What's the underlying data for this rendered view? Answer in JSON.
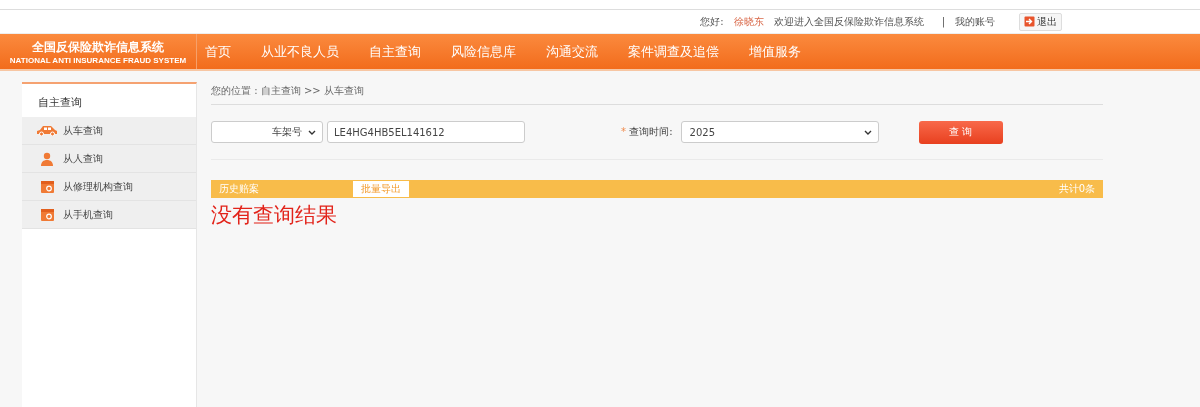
{
  "user_bar": {
    "greeting": "您好:",
    "user_name": "徐晓东",
    "welcome": "欢迎进入全国反保险欺诈信息系统",
    "separator": "|",
    "account_link": "我的账号",
    "logout_button": "退出"
  },
  "logo": {
    "title": "全国反保险欺诈信息系统",
    "subtitle": "NATIONAL ANTI INSURANCE FRAUD SYSTEM"
  },
  "nav": [
    {
      "label": "首页"
    },
    {
      "label": "从业不良人员"
    },
    {
      "label": "自主查询"
    },
    {
      "label": "风险信息库"
    },
    {
      "label": "沟通交流"
    },
    {
      "label": "案件调查及追偿"
    },
    {
      "label": "增值服务"
    }
  ],
  "sidebar": {
    "title": "自主查询",
    "items": [
      {
        "label": "从车查询",
        "kind": "car"
      },
      {
        "label": "从人查询",
        "kind": "person"
      },
      {
        "label": "从修理机构查询",
        "kind": "calendar"
      },
      {
        "label": "从手机查询",
        "kind": "calendar"
      }
    ]
  },
  "breadcrumb": "您的位置 : 自主查询 >> 从车查询",
  "search": {
    "type_select": "车架号",
    "vin_value": "LE4HG4HB5EL141612",
    "time_label": "查询时间:",
    "required_mark": "*",
    "time_select": "2025",
    "query_button": "查 询"
  },
  "results": {
    "title": "历史赔案",
    "export_button": "批量导出",
    "total": "共计0条",
    "empty_message": "没有查询结果"
  }
}
